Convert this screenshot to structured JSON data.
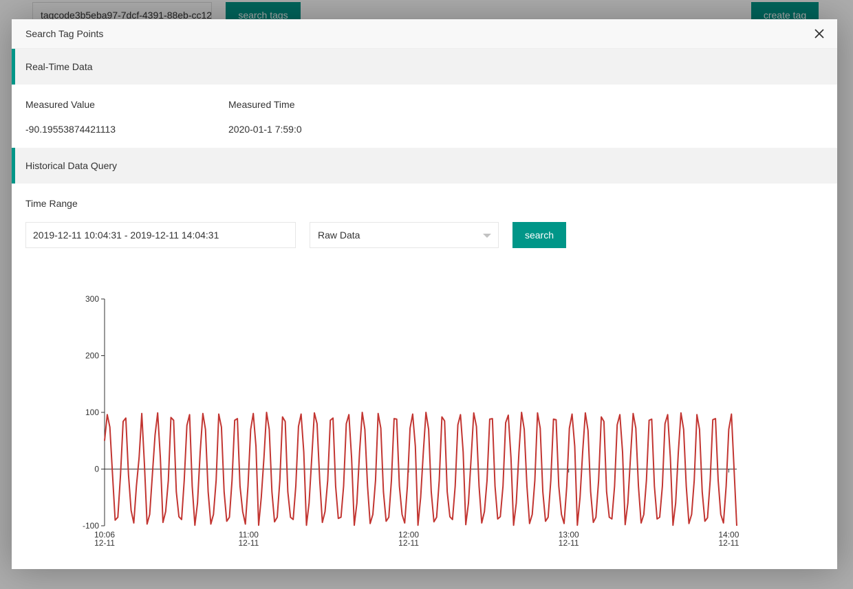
{
  "background": {
    "tag_input_value": "tagcode3b5eba97-7dcf-4391-88eb-cc12",
    "search_tags_label": "search tags",
    "create_tag_label": "create tag"
  },
  "modal": {
    "title": "Search Tag Points",
    "close_icon": "close-icon"
  },
  "realtime": {
    "section_title": "Real-Time Data",
    "measured_value_label": "Measured Value",
    "measured_time_label": "Measured Time",
    "measured_value": "-90.19553874421113",
    "measured_time": "2020-01-1 7:59:0"
  },
  "historical": {
    "section_title": "Historical Data Query",
    "time_range_label": "Time Range",
    "time_range_value": "2019-12-11 10:04:31 - 2019-12-11 14:04:31",
    "data_mode_selected": "Raw Data",
    "search_label": "search"
  },
  "colors": {
    "accent": "#009688",
    "series": "#c23531"
  },
  "chart_data": {
    "type": "line",
    "title": "",
    "xlabel": "",
    "ylabel": "",
    "ylim": [
      -100,
      300
    ],
    "yticks": [
      "300",
      "200",
      "100",
      "0",
      "-100"
    ],
    "xticks": [
      {
        "time": "10:06",
        "date": "12-11"
      },
      {
        "time": "11:00",
        "date": "12-11"
      },
      {
        "time": "12:00",
        "date": "12-11"
      },
      {
        "time": "13:00",
        "date": "12-11"
      },
      {
        "time": "14:00",
        "date": "12-11"
      }
    ],
    "xrange": [
      "2019-12-11 10:04:31",
      "2019-12-11 14:04:31"
    ],
    "grid": false,
    "series": [
      {
        "sample_interval_minutes": 1,
        "values": [
          50,
          96,
          74,
          -10,
          -90,
          -85,
          -10,
          84,
          90,
          -10,
          -73,
          -95,
          -30,
          20,
          98,
          10,
          -97,
          -80,
          -10,
          60,
          99,
          20,
          -94,
          -75,
          -20,
          91,
          86,
          -40,
          -84,
          -89,
          -20,
          77,
          96,
          -30,
          -99,
          -60,
          30,
          98,
          70,
          -40,
          -97,
          -80,
          -20,
          97,
          74,
          -40,
          -92,
          -85,
          -20,
          86,
          89,
          -30,
          -75,
          -97,
          -30,
          70,
          98,
          40,
          -99,
          -50,
          20,
          100,
          70,
          -40,
          -93,
          -85,
          -20,
          92,
          84,
          -40,
          -85,
          -89,
          -30,
          75,
          97,
          30,
          -99,
          -60,
          20,
          99,
          80,
          -20,
          -94,
          -75,
          -20,
          86,
          90,
          -30,
          -87,
          -85,
          -30,
          80,
          96,
          20,
          -99,
          -60,
          30,
          100,
          70,
          -30,
          -96,
          -80,
          -20,
          98,
          72,
          -40,
          -92,
          -85,
          -20,
          89,
          88,
          -30,
          -80,
          -95,
          -30,
          72,
          97,
          40,
          -99,
          -50,
          30,
          100,
          70,
          -40,
          -93,
          -85,
          -20,
          92,
          85,
          -40,
          -84,
          -89,
          -30,
          78,
          96,
          30,
          -98,
          -60,
          20,
          99,
          75,
          -30,
          -95,
          -75,
          -20,
          88,
          89,
          -30,
          -88,
          -84,
          -30,
          82,
          95,
          20,
          -99,
          -60,
          30,
          100,
          70,
          -30,
          -96,
          -80,
          -20,
          99,
          72,
          -40,
          -92,
          -85,
          -20,
          88,
          87,
          -30,
          -80,
          -96,
          -30,
          72,
          97,
          40,
          -99,
          -50,
          30,
          99,
          68,
          -40,
          -94,
          -85,
          -20,
          92,
          84,
          -40,
          -85,
          -88,
          -30,
          78,
          96,
          30,
          -98,
          -60,
          20,
          98,
          72,
          -30,
          -95,
          -80,
          -20,
          86,
          88,
          -30,
          -88,
          -85,
          -30,
          80,
          96,
          20,
          -99,
          -60,
          30,
          99,
          70,
          -30,
          -96,
          -80,
          -20,
          96,
          70,
          -40,
          -92,
          -86,
          -20,
          87,
          89,
          -20,
          -80,
          -95,
          -30,
          70,
          97,
          0,
          -100
        ]
      }
    ]
  }
}
